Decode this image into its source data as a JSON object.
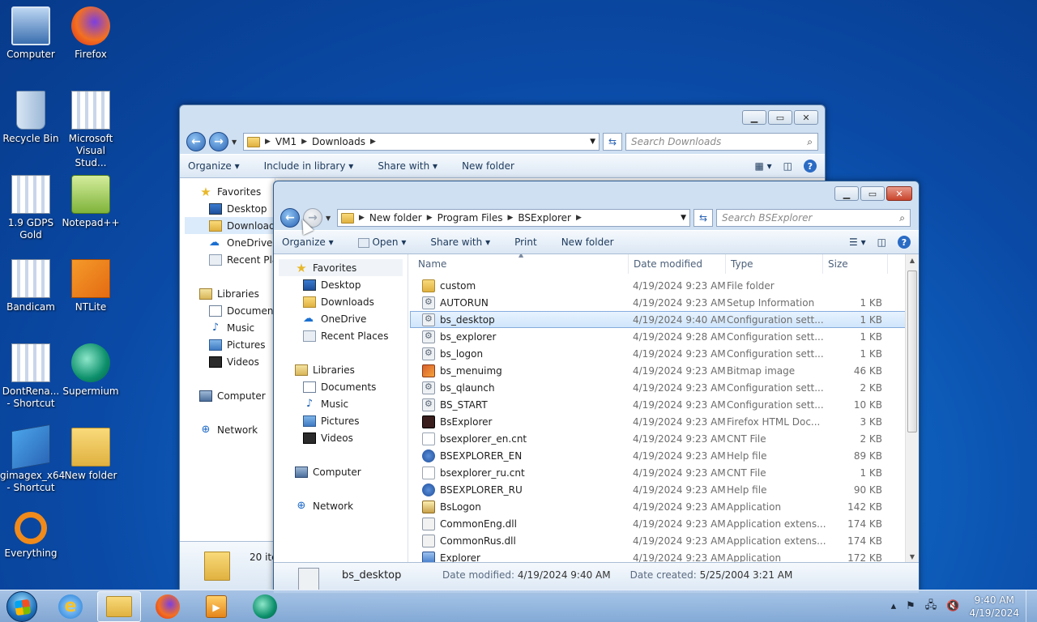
{
  "desktop": {
    "icons": [
      {
        "label": "Computer",
        "icon": "computer-icon"
      },
      {
        "label": "Firefox",
        "icon": "firefox-icon"
      },
      {
        "label": "Recycle Bin",
        "icon": "recycle-bin-icon"
      },
      {
        "label": "Microsoft Visual Stud...",
        "icon": "generic-app-icon"
      },
      {
        "label": "1.9 GDPS Gold",
        "icon": "generic-app-icon"
      },
      {
        "label": "Notepad++",
        "icon": "notepadpp-icon"
      },
      {
        "label": "Bandicam",
        "icon": "generic-app-icon"
      },
      {
        "label": "NTLite",
        "icon": "ntlite-icon"
      },
      {
        "label": "DontRena... - Shortcut",
        "icon": "generic-app-icon"
      },
      {
        "label": "Supermium",
        "icon": "supermium-icon"
      },
      {
        "label": "gimagex_x64 - Shortcut",
        "icon": "setup-icon"
      },
      {
        "label": "New folder",
        "icon": "folder-icon"
      },
      {
        "label": "Everything",
        "icon": "everything-icon"
      }
    ]
  },
  "back_window": {
    "breadcrumb": [
      "VM1",
      "Downloads"
    ],
    "search_placeholder": "Search Downloads",
    "toolbar": {
      "organize": "Organize",
      "include": "Include in library",
      "share": "Share with",
      "newfolder": "New folder"
    },
    "nav": {
      "favorites": "Favorites",
      "desktop": "Desktop",
      "downloads": "Downloads",
      "onedrive": "OneDrive",
      "recent": "Recent Places",
      "libraries": "Libraries",
      "documents": "Documents",
      "music": "Music",
      "pictures": "Pictures",
      "videos": "Videos",
      "computer": "Computer",
      "network": "Network"
    },
    "status_count": "20 ite"
  },
  "front_window": {
    "breadcrumb": [
      "New folder",
      "Program Files",
      "BSExplorer"
    ],
    "search_placeholder": "Search BSExplorer",
    "toolbar": {
      "organize": "Organize",
      "open": "Open",
      "share": "Share with",
      "print": "Print",
      "newfolder": "New folder"
    },
    "nav": {
      "favorites": "Favorites",
      "desktop": "Desktop",
      "downloads": "Downloads",
      "onedrive": "OneDrive",
      "recent": "Recent Places",
      "libraries": "Libraries",
      "documents": "Documents",
      "music": "Music",
      "pictures": "Pictures",
      "videos": "Videos",
      "computer": "Computer",
      "network": "Network"
    },
    "columns": {
      "name": "Name",
      "date": "Date modified",
      "type": "Type",
      "size": "Size"
    },
    "files": [
      {
        "name": "custom",
        "date": "4/19/2024 9:23 AM",
        "type": "File folder",
        "size": "",
        "icon": "folder"
      },
      {
        "name": "AUTORUN",
        "date": "4/19/2024 9:23 AM",
        "type": "Setup Information",
        "size": "1 KB",
        "icon": "config"
      },
      {
        "name": "bs_desktop",
        "date": "4/19/2024 9:40 AM",
        "type": "Configuration sett...",
        "size": "1 KB",
        "icon": "config",
        "selected": true
      },
      {
        "name": "bs_explorer",
        "date": "4/19/2024 9:28 AM",
        "type": "Configuration sett...",
        "size": "1 KB",
        "icon": "config"
      },
      {
        "name": "bs_logon",
        "date": "4/19/2024 9:23 AM",
        "type": "Configuration sett...",
        "size": "1 KB",
        "icon": "config"
      },
      {
        "name": "bs_menuimg",
        "date": "4/19/2024 9:23 AM",
        "type": "Bitmap image",
        "size": "46 KB",
        "icon": "bitmap"
      },
      {
        "name": "bs_qlaunch",
        "date": "4/19/2024 9:23 AM",
        "type": "Configuration sett...",
        "size": "2 KB",
        "icon": "config"
      },
      {
        "name": "BS_START",
        "date": "4/19/2024 9:23 AM",
        "type": "Configuration sett...",
        "size": "10 KB",
        "icon": "config"
      },
      {
        "name": "BsExplorer",
        "date": "4/19/2024 9:23 AM",
        "type": "Firefox HTML Doc...",
        "size": "3 KB",
        "icon": "html"
      },
      {
        "name": "bsexplorer_en.cnt",
        "date": "4/19/2024 9:23 AM",
        "type": "CNT File",
        "size": "2 KB",
        "icon": "cnt"
      },
      {
        "name": "BSEXPLORER_EN",
        "date": "4/19/2024 9:23 AM",
        "type": "Help file",
        "size": "89 KB",
        "icon": "help"
      },
      {
        "name": "bsexplorer_ru.cnt",
        "date": "4/19/2024 9:23 AM",
        "type": "CNT File",
        "size": "1 KB",
        "icon": "cnt"
      },
      {
        "name": "BSEXPLORER_RU",
        "date": "4/19/2024 9:23 AM",
        "type": "Help file",
        "size": "90 KB",
        "icon": "help"
      },
      {
        "name": "BsLogon",
        "date": "4/19/2024 9:23 AM",
        "type": "Application",
        "size": "142 KB",
        "icon": "app"
      },
      {
        "name": "CommonEng.dll",
        "date": "4/19/2024 9:23 AM",
        "type": "Application extens...",
        "size": "174 KB",
        "icon": "dll"
      },
      {
        "name": "CommonRus.dll",
        "date": "4/19/2024 9:23 AM",
        "type": "Application extens...",
        "size": "174 KB",
        "icon": "dll"
      },
      {
        "name": "Explorer",
        "date": "4/19/2024 9:23 AM",
        "type": "Application",
        "size": "172 KB",
        "icon": "exe"
      }
    ],
    "details": {
      "name": "bs_desktop",
      "modified_label": "Date modified:",
      "modified": "4/19/2024 9:40 AM",
      "created_label": "Date created:",
      "created": "5/25/2004 3:21 AM"
    }
  },
  "taskbar": {
    "time": "9:40 AM",
    "date": "4/19/2024"
  },
  "colors": {
    "accent": "#2b63b4",
    "selection": "#cfe5fc",
    "folder": "#e0b140"
  }
}
